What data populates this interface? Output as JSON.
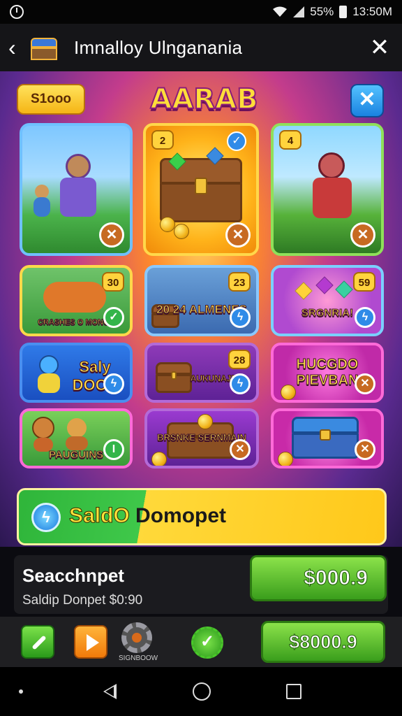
{
  "status_bar": {
    "indicator": "55%",
    "time": "13:50M",
    "icons": [
      "clock-icon",
      "wifi-icon",
      "signal-icon",
      "battery-icon"
    ]
  },
  "title_bar": {
    "title": "Imnalloy Ulnganania"
  },
  "game": {
    "balance_label": "S1ooo",
    "logo_text": "AARAB",
    "cards": [
      {
        "badge": "",
        "action": "✕"
      },
      {
        "badge": "2",
        "action": "✕"
      },
      {
        "badge": "4",
        "action": "✕"
      },
      {
        "badge": "30",
        "label": "CRASHES O MONCH",
        "action": "✓"
      },
      {
        "badge": "23",
        "label": "20 24 ALMENES",
        "action": "ϟ"
      },
      {
        "badge": "59",
        "label": "SRGNRIA!",
        "action": "ϟ"
      },
      {
        "label": "Saly DOCK",
        "action": "ϟ"
      },
      {
        "badge": "28",
        "label": "AUKUNAJE",
        "action": "ϟ"
      },
      {
        "label": "HUCGDO PIEVBAN",
        "action": "✕"
      },
      {
        "label": "PAUGUINS",
        "action": "I"
      },
      {
        "label": "BRSNKE SERNMAIN",
        "action": "✕"
      },
      {
        "label": "",
        "action": "✕"
      }
    ]
  },
  "claim": {
    "label_highlight": "SaldO",
    "label_rest": "Domopet"
  },
  "info": {
    "title": "Seacchnpet",
    "subtitle": "Saldip Donpet",
    "subtitle_price": "$0:90",
    "price_button": "$000.9"
  },
  "toolbar": {
    "gear_label": "SIGNBOOW",
    "price_button": "$8000.9"
  }
}
